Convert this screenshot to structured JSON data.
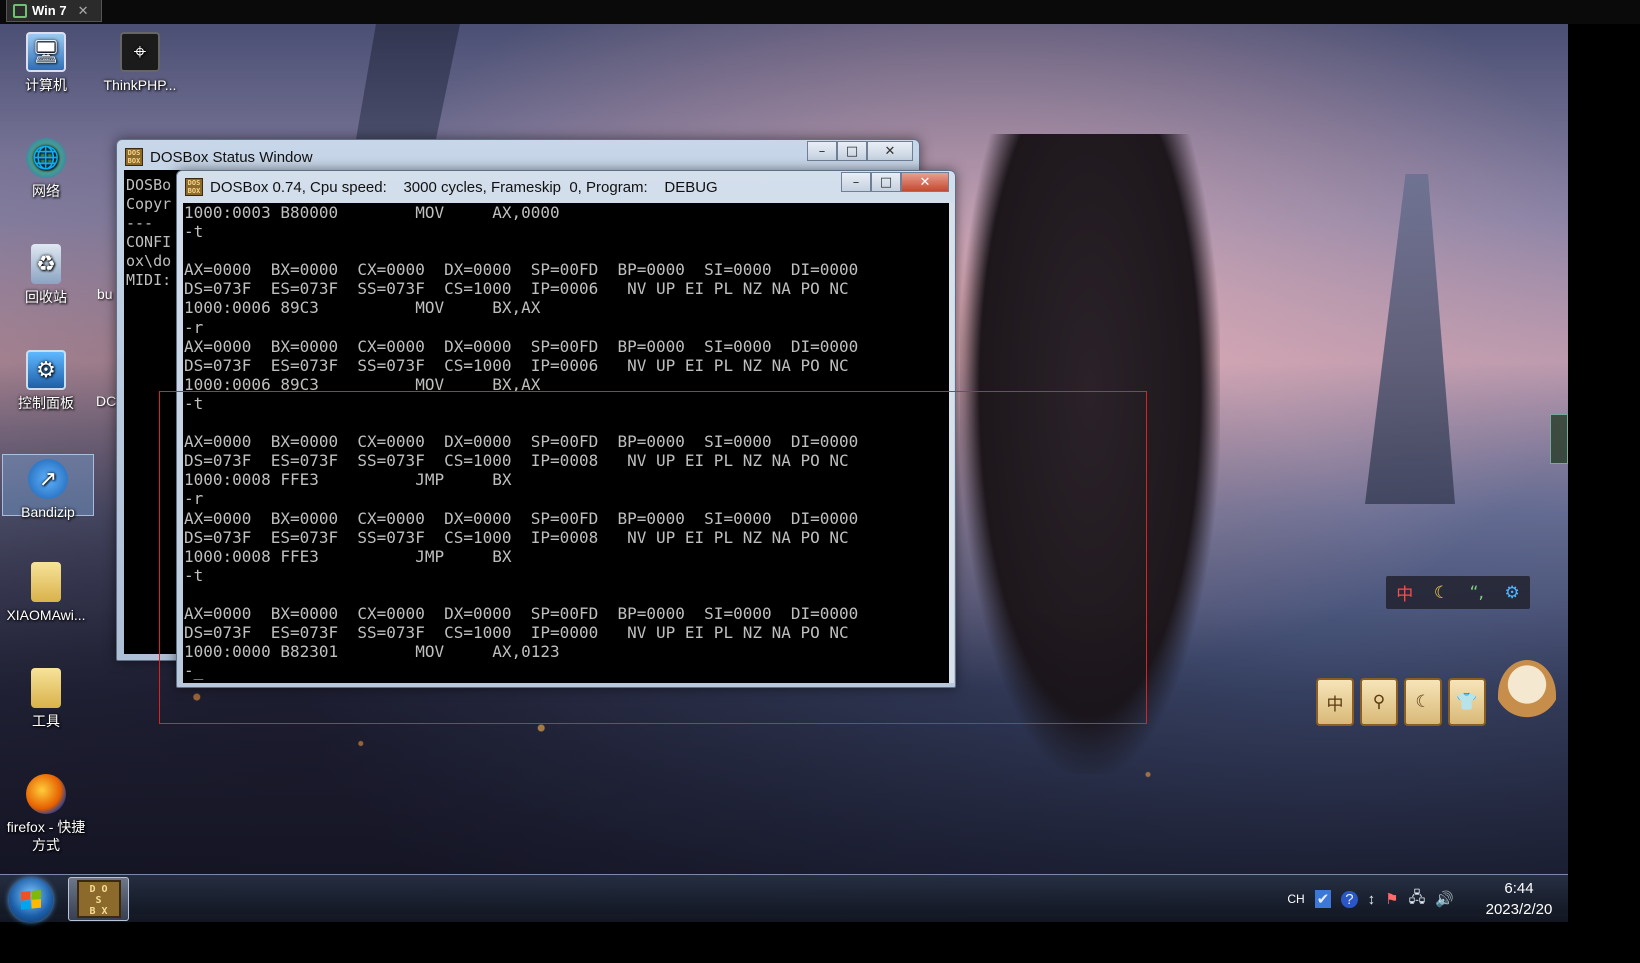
{
  "vm": {
    "tab_label": "Win 7",
    "tab_close": "✕"
  },
  "desktop_icons": [
    {
      "name": "computer",
      "label": "计算机",
      "icon": "computer-icon"
    },
    {
      "name": "thinkphp",
      "label": "ThinkPHP...",
      "icon": "thinkphp-icon"
    },
    {
      "name": "network",
      "label": "网络",
      "icon": "network-icon"
    },
    {
      "name": "recycle-bin",
      "label": "回收站",
      "icon": "recycle-bin-icon"
    },
    {
      "name": "control-panel",
      "label": "控制面板",
      "icon": "control-panel-icon"
    },
    {
      "name": "bandizip",
      "label": "Bandizip",
      "icon": "bandizip-icon"
    },
    {
      "name": "xiaoma",
      "label": "XIAOMAwi...",
      "icon": "folder-icon"
    },
    {
      "name": "tools",
      "label": "工具",
      "icon": "folder-icon"
    },
    {
      "name": "firefox",
      "label": "firefox - 快捷方式",
      "icon": "firefox-icon"
    }
  ],
  "partial_labels": {
    "bu": "bu",
    "dc": "DC"
  },
  "status_window": {
    "title": "DOSBox Status Window",
    "lines": [
      "DOSBo",
      "Copyr",
      "---",
      "CONFI",
      "ox\\do",
      "MIDI:"
    ]
  },
  "dosbox_window": {
    "title": "DOSBox 0.74, Cpu speed:    3000 cycles, Frameskip  0, Program:    DEBUG",
    "console": [
      "1000:0003 B80000        MOV     AX,0000",
      "-t",
      "",
      "AX=0000  BX=0000  CX=0000  DX=0000  SP=00FD  BP=0000  SI=0000  DI=0000",
      "DS=073F  ES=073F  SS=073F  CS=1000  IP=0006   NV UP EI PL NZ NA PO NC",
      "1000:0006 89C3          MOV     BX,AX",
      "-r",
      "AX=0000  BX=0000  CX=0000  DX=0000  SP=00FD  BP=0000  SI=0000  DI=0000",
      "DS=073F  ES=073F  SS=073F  CS=1000  IP=0006   NV UP EI PL NZ NA PO NC",
      "1000:0006 89C3          MOV     BX,AX",
      "-t",
      "",
      "AX=0000  BX=0000  CX=0000  DX=0000  SP=00FD  BP=0000  SI=0000  DI=0000",
      "DS=073F  ES=073F  SS=073F  CS=1000  IP=0008   NV UP EI PL NZ NA PO NC",
      "1000:0008 FFE3          JMP     BX",
      "-r",
      "AX=0000  BX=0000  CX=0000  DX=0000  SP=00FD  BP=0000  SI=0000  DI=0000",
      "DS=073F  ES=073F  SS=073F  CS=1000  IP=0008   NV UP EI PL NZ NA PO NC",
      "1000:0008 FFE3          JMP     BX",
      "-t",
      "",
      "AX=0000  BX=0000  CX=0000  DX=0000  SP=00FD  BP=0000  SI=0000  DI=0000",
      "DS=073F  ES=073F  SS=073F  CS=1000  IP=0000   NV UP EI PL NZ NA PO NC",
      "1000:0000 B82301        MOV     AX,0123",
      "-_"
    ]
  },
  "ime_toolbar": {
    "items": [
      "中",
      "☾",
      "“,",
      "⚙"
    ]
  },
  "widgets": [
    "中",
    "⚲",
    "☾",
    "👕"
  ],
  "taskbar": {
    "dosbox_label": "D O\nS\nB X",
    "tray": {
      "lang": "CH",
      "time": "6:44",
      "date": "2023/2/20"
    }
  },
  "colors": {
    "selection_box": "#dd2222",
    "console_text": "#bfbfbf"
  }
}
